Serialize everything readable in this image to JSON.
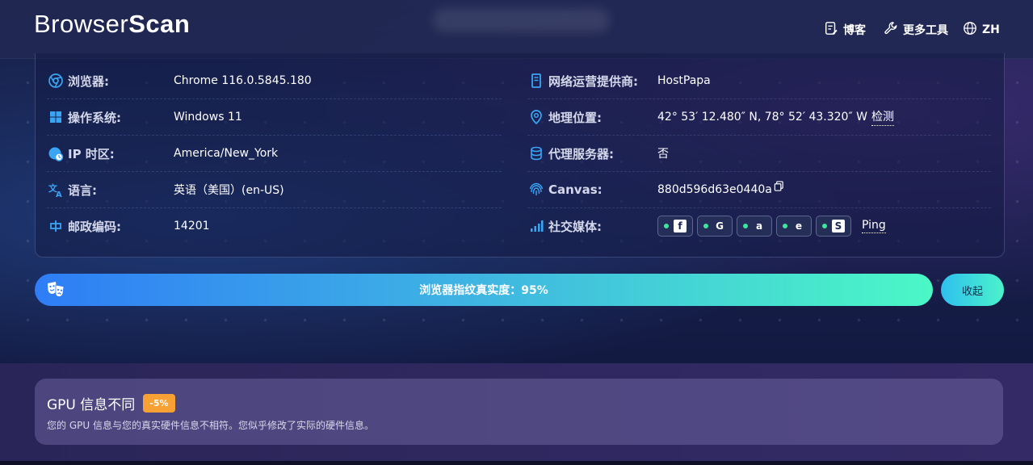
{
  "header": {
    "logo_part1": "Browser",
    "logo_part2": "Scan",
    "nav": [
      {
        "icon": "document-edit-icon",
        "label": "博客"
      },
      {
        "icon": "wrench-icon",
        "label": "更多工具"
      },
      {
        "icon": "globe-icon",
        "label": "ZH"
      }
    ]
  },
  "info": {
    "left": [
      {
        "icon": "chrome-icon",
        "label": "浏览器:",
        "value": "Chrome 116.0.5845.180"
      },
      {
        "icon": "windows-icon",
        "label": "操作系统:",
        "value": "Windows 11"
      },
      {
        "icon": "globe-clock-icon",
        "label": "IP 时区:",
        "value": "America/New_York"
      },
      {
        "icon": "translate-icon",
        "label": "语言:",
        "value": "英语（美国）(en-US)"
      },
      {
        "icon": "postal-icon",
        "label": "邮政编码:",
        "value": "14201"
      }
    ],
    "right": [
      {
        "icon": "server-icon",
        "label": "网络运营提供商:",
        "value": "HostPapa"
      },
      {
        "icon": "location-pin-icon",
        "label": "地理位置:",
        "value": "42° 53′ 12.480″ N, 78° 52′ 43.320″ W",
        "link": "检测"
      },
      {
        "icon": "database-icon",
        "label": "代理服务器:",
        "value": "否"
      },
      {
        "icon": "fingerprint-icon",
        "label": "Canvas:",
        "value": "880d596d63e0440a"
      },
      {
        "icon": "signal-bars-icon",
        "label": "社交媒体:",
        "value": ""
      }
    ],
    "social": [
      {
        "icon": "facebook-icon",
        "glyph": "f"
      },
      {
        "icon": "google-icon",
        "glyph": "G"
      },
      {
        "icon": "amazon-icon",
        "glyph": "a"
      },
      {
        "icon": "edge-icon",
        "glyph": "e"
      },
      {
        "icon": "shopify-icon",
        "glyph": "S"
      }
    ],
    "ping_label": "Ping"
  },
  "fingerprint_bar": {
    "label": "浏览器指纹真实度：95%",
    "value_percent": 95,
    "collapse_label": "收起"
  },
  "alert": {
    "title": "GPU 信息不同",
    "badge": "-5%",
    "description": "您的 GPU 信息与您的真实硬件信息不相符。您似乎修改了实际的硬件信息。"
  },
  "colors": {
    "accent_cyan": "#4bf8c6",
    "accent_blue": "#2f7df6",
    "icon_blue": "#3aa5f5",
    "badge_orange": "#f7a034",
    "status_green": "#3ee59e"
  }
}
